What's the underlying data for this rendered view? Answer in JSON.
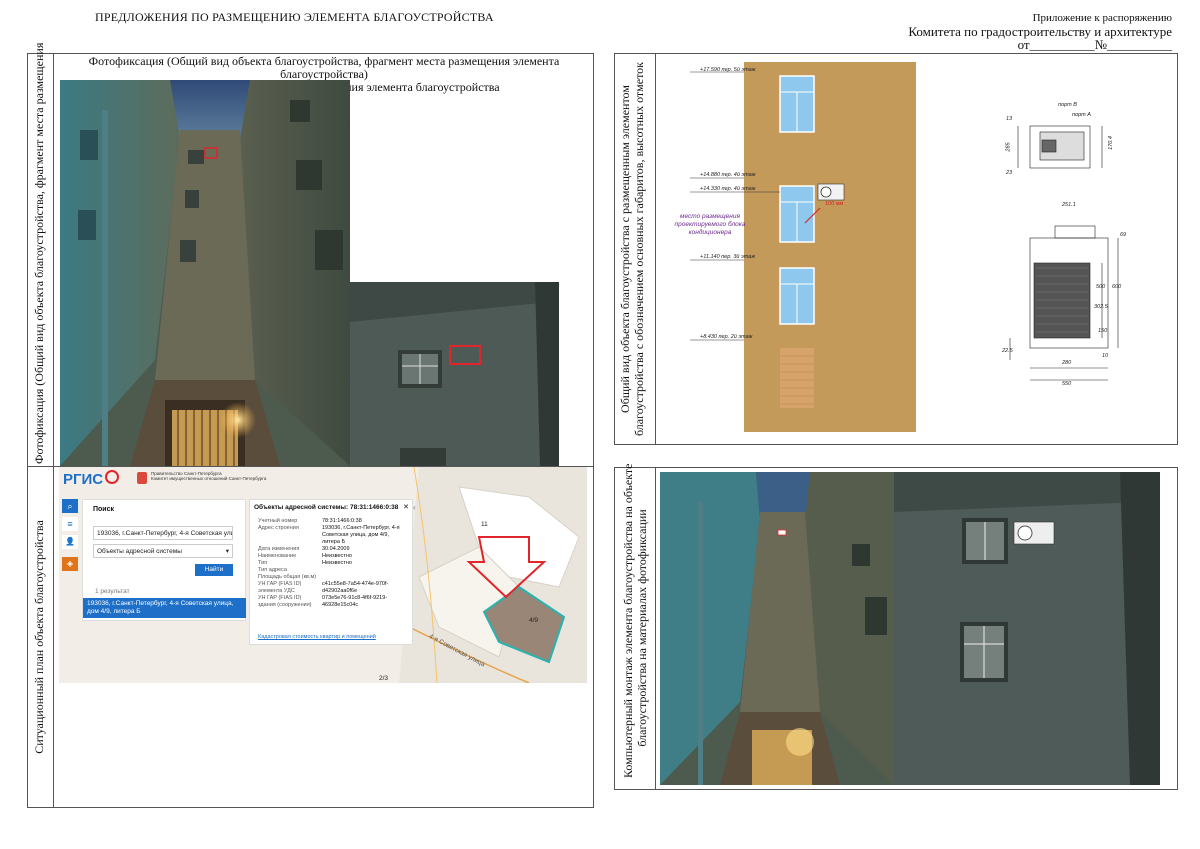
{
  "header": {
    "title": "ПРЕДЛОЖЕНИЯ ПО РАЗМЕЩЕНИЮ ЭЛЕМЕНТА БЛАГОУСТРОЙСТВА",
    "appendix_line1": "Приложение к распоряжению",
    "appendix_line2": "Комитета по градостроительству и архитектуре",
    "appendix_line3": "от__________№__________"
  },
  "photo_section": {
    "side_label": "Фотофиксация (Общий вид объекта благоустройства, фрагмент места размещения",
    "caption_line1": "Фотофиксация (Общий вид объекта благоустройства, фрагмент места размещения элемента благоустройства)",
    "caption_line2": "заполняется по состоянию до размещения элемента благоустройства"
  },
  "situation_section": {
    "side_label": "Ситуационный план объекта благоустройства",
    "map": {
      "logo": "РГИС",
      "gov_line1": "Правительство Санкт-Петербурга",
      "gov_line2": "Комитет имущественных отношений Санкт-Петербурга",
      "search_title": "Поиск",
      "search_value": "193036, г.Санкт-Петербург, 4-я Советская улица,",
      "select_value": "Объекты адресной системы",
      "find_button": "Найти",
      "results_count": "1 результат",
      "result_text": "193036, г.Санкт-Петербург, 4-я Советская улица, дом 4/9, литера Б",
      "info_title": "Объекты адресной системы: 78:31:1466:0:38",
      "info_rows": [
        [
          "Учетный номер",
          "78:31:1466:0:38"
        ],
        [
          "Адрес строения",
          "193036, г.Санкт-Петербург, 4-я Советская улица, дом 4/9, литера Б"
        ],
        [
          "Дата изменения",
          "30.04.2009"
        ],
        [
          "Наименование",
          "Неизвестно"
        ],
        [
          "Тип",
          "Неизвестно"
        ],
        [
          "Тип адреса",
          ""
        ],
        [
          "Площадь общая (кв.м)",
          ""
        ],
        [
          "УН ГАР (FIAS ID) элемента УДС",
          "c41c55e8-7a54-474e-970f-d42902aa0f6e"
        ],
        [
          "УН ГАР (FIAS ID) здания (сооружения)",
          "073e5e76-91c8-4f6f-9219-46928e15c04c"
        ]
      ],
      "info_link": "Кадастровая стоимость квартир и помещений",
      "street_label": "4-я Советская улица",
      "building_label": "4/9",
      "building_label2": "11",
      "building_label3": "2/3"
    }
  },
  "general_view_section": {
    "side_label_line1": "Общий вид объекта благоустройства с размещенным элементом",
    "side_label_line2": "благоустройства с обозначением основных габаритов, высотных отметок",
    "marks": [
      "+17.590  пер. 5й этаж",
      "+14.880  пер. 4й этаж",
      "+14.330  пер. 4й этаж",
      "+11.140  пер. 3й этаж",
      "+8.430  пер. 2й этаж"
    ],
    "unit_note": "100 мм",
    "placement_note_line1": "место размещения",
    "placement_note_line2": "проектируемого блока",
    "placement_note_line3": "кондиционера",
    "dims": [
      "285",
      "170.4",
      "23",
      "13",
      "порт В",
      "порт А",
      "251.1",
      "500",
      "600",
      "302.5",
      "150",
      "22.5",
      "280",
      "550",
      "10",
      "69"
    ]
  },
  "montage_section": {
    "side_label_line1": "Компьютерный монтаж элемента благоустройства на объекте",
    "side_label_line2": "благоустройства на материалах фотофиксации"
  },
  "colors": {
    "facade": "#c49a5a",
    "window": "#8fc8ef",
    "highlight": "#e0262a",
    "map_blue": "#1e6fc7",
    "building_fill": "#9a8676",
    "building_outline": "#27b3b0"
  }
}
